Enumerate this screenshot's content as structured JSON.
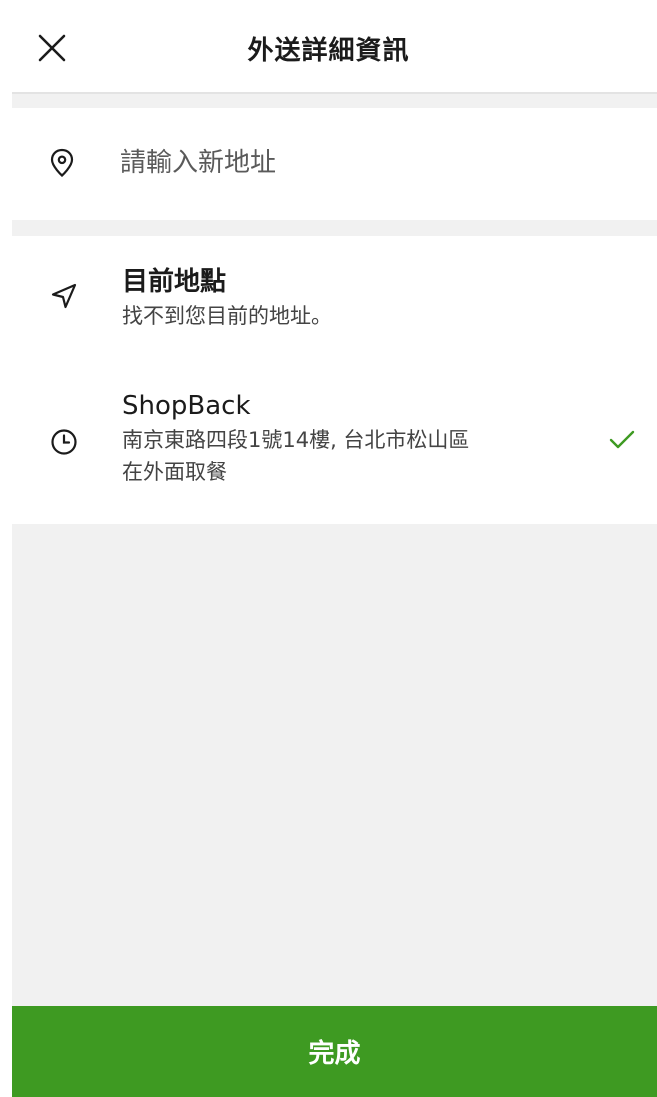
{
  "header": {
    "title": "外送詳細資訊",
    "close_icon": "close-icon"
  },
  "search": {
    "placeholder": "請輸入新地址",
    "value": "",
    "icon": "location-pin-icon"
  },
  "locations": {
    "current": {
      "icon": "navigation-arrow-icon",
      "title": "目前地點",
      "subtitle": "找不到您目前的地址。"
    },
    "saved": {
      "icon": "clock-icon",
      "name": "ShopBack",
      "address": "南京東路四段1號14樓, 台北市松山區",
      "note": "在外面取餐",
      "selected": true,
      "check_icon": "check-icon"
    }
  },
  "footer": {
    "done_label": "完成"
  },
  "colors": {
    "accent": "#3e9a22",
    "check": "#3e9a22",
    "background_gray": "#f1f1f1"
  }
}
